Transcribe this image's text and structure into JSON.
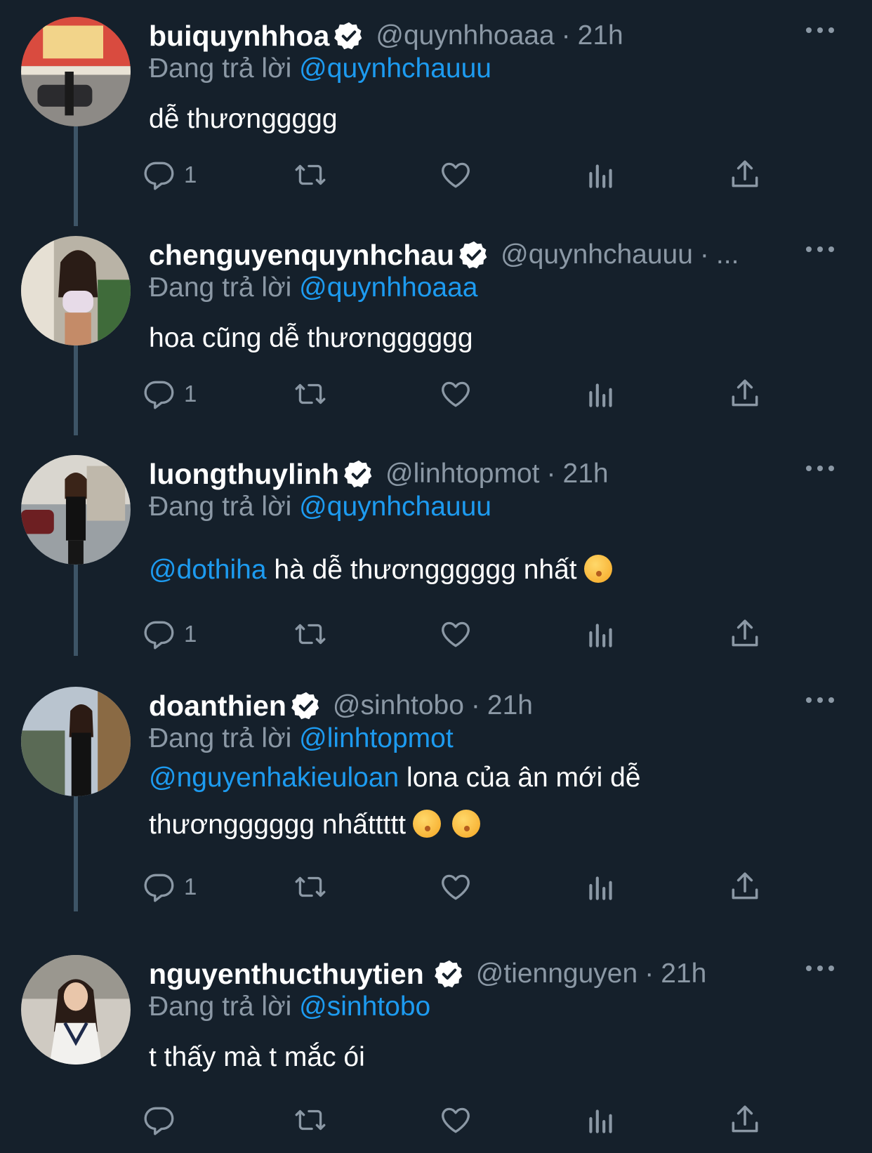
{
  "replying_prefix": "Đang trả lời",
  "tweets": [
    {
      "name": "buiquynhhoa",
      "handle": "@quynhhoaaa",
      "dot": "·",
      "time": "21h",
      "reply_to": "@quynhchauuu",
      "text_mention": "",
      "text": "dễ thươnggggg",
      "text_line2": "",
      "reply_count": "1"
    },
    {
      "name": "chenguyenquynhchau",
      "handle": "@quynhchauuu",
      "dot": "·",
      "time": "...",
      "reply_to": "@quynhhoaaa",
      "text_mention": "",
      "text": "hoa cũng dễ thươngggggg",
      "text_line2": "",
      "reply_count": "1"
    },
    {
      "name": "luongthuylinh",
      "handle": "@linhtopmot",
      "dot": "·",
      "time": "21h",
      "reply_to": "@quynhchauuu",
      "text_mention": "@dothiha",
      "text": "hà dễ thươngggggg nhất",
      "text_line2": "",
      "reply_count": "1",
      "emojis": [
        "kissing-heart-emoji"
      ]
    },
    {
      "name": "doanthien",
      "handle": "@sinhtobo",
      "dot": "·",
      "time": "21h",
      "reply_to": "@linhtopmot",
      "text_mention": "@nguyenhakieuloan",
      "text": "lona của ân mới dễ",
      "text_line2": "thươngggggg nhấttttt",
      "reply_count": "1",
      "emojis": [
        "kissing-emoji",
        "kissing-emoji"
      ]
    },
    {
      "name": "nguyenthucthuytien",
      "handle": "@tiennguyen",
      "dot": "·",
      "time": "21h",
      "reply_to": "@sinhtobo",
      "text_mention": "",
      "text": "t thấy mà t mắc ói",
      "text_line2": "",
      "reply_count": ""
    }
  ],
  "colors": {
    "background": "#15202b",
    "secondary_text": "#8b98a5",
    "mention": "#1d9bf0",
    "thread_line": "#3d5466"
  },
  "icons": [
    "reply-icon",
    "retweet-icon",
    "like-icon",
    "analytics-icon",
    "share-icon",
    "verified-badge-icon",
    "more-options-icon"
  ]
}
